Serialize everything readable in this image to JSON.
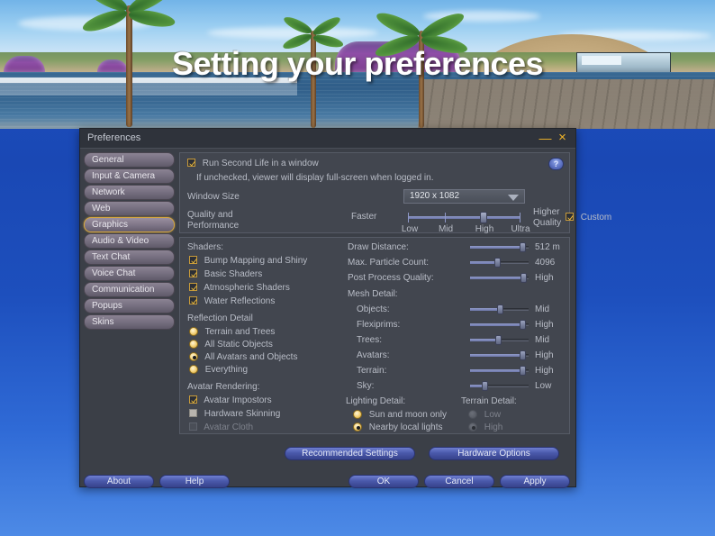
{
  "slide": {
    "title": "Setting your preferences"
  },
  "window": {
    "title": "Preferences",
    "minimize_label": "—",
    "close_label": "×",
    "help_label": "?"
  },
  "sidebar": {
    "items": [
      {
        "label": "General",
        "selected": false
      },
      {
        "label": "Input & Camera",
        "selected": false
      },
      {
        "label": "Network",
        "selected": false
      },
      {
        "label": "Web",
        "selected": false
      },
      {
        "label": "Graphics",
        "selected": true
      },
      {
        "label": "Audio & Video",
        "selected": false
      },
      {
        "label": "Text Chat",
        "selected": false
      },
      {
        "label": "Voice Chat",
        "selected": false
      },
      {
        "label": "Communication",
        "selected": false
      },
      {
        "label": "Popups",
        "selected": false
      },
      {
        "label": "Skins",
        "selected": false
      }
    ]
  },
  "top_panel": {
    "run_in_window_label": "Run Second Life in a window",
    "run_in_window_checked": true,
    "hint": "If unchecked, viewer will display full-screen when logged in.",
    "window_size_label": "Window Size",
    "window_size_value": "1920 x 1082",
    "quality_label_line1": "Quality and",
    "quality_label_line2": "Performance",
    "faster_label": "Faster",
    "higher_quality_line1": "Higher",
    "higher_quality_line2": "Quality",
    "quality_ticks": [
      "Low",
      "Mid",
      "High",
      "Ultra"
    ],
    "quality_value": "High",
    "custom_label": "Custom",
    "custom_checked": true
  },
  "shaders": {
    "heading": "Shaders:",
    "items": [
      {
        "label": "Bump Mapping and Shiny",
        "checked": true
      },
      {
        "label": "Basic Shaders",
        "checked": true
      },
      {
        "label": "Atmospheric Shaders",
        "checked": true
      },
      {
        "label": "Water Reflections",
        "checked": true
      }
    ]
  },
  "reflection_detail": {
    "heading": "Reflection Detail",
    "options": [
      {
        "label": "Terrain and Trees",
        "selected": false
      },
      {
        "label": "All Static Objects",
        "selected": false
      },
      {
        "label": "All Avatars and Objects",
        "selected": true
      },
      {
        "label": "Everything",
        "selected": false
      }
    ]
  },
  "avatar_rendering": {
    "heading": "Avatar Rendering:",
    "items": [
      {
        "label": "Avatar Impostors",
        "checked": true,
        "disabled": false
      },
      {
        "label": "Hardware Skinning",
        "checked": false,
        "disabled": false
      },
      {
        "label": "Avatar Cloth",
        "checked": false,
        "disabled": true
      }
    ]
  },
  "sliders": {
    "items": [
      {
        "label": "Draw Distance:",
        "value": "512 m",
        "pct": 88
      },
      {
        "label": "Max. Particle Count:",
        "value": "4096",
        "pct": 45
      },
      {
        "label": "Post Process Quality:",
        "value": "High",
        "pct": 90
      }
    ],
    "mesh_heading": "Mesh Detail:",
    "mesh": [
      {
        "label": "Objects:",
        "value": "Mid",
        "pct": 50
      },
      {
        "label": "Flexiprims:",
        "value": "High",
        "pct": 89
      },
      {
        "label": "Trees:",
        "value": "Mid",
        "pct": 46
      },
      {
        "label": "Avatars:",
        "value": "High",
        "pct": 89
      },
      {
        "label": "Terrain:",
        "value": "High",
        "pct": 89
      },
      {
        "label": "Sky:",
        "value": "Low",
        "pct": 25
      }
    ]
  },
  "lighting_detail": {
    "heading": "Lighting Detail:",
    "options": [
      {
        "label": "Sun and moon only",
        "selected": false
      },
      {
        "label": "Nearby local lights",
        "selected": true
      }
    ]
  },
  "terrain_detail": {
    "heading": "Terrain Detail:",
    "options": [
      {
        "label": "Low",
        "selected": false,
        "disabled": true
      },
      {
        "label": "High",
        "selected": true,
        "disabled": true
      }
    ]
  },
  "actions": {
    "recommended_settings": "Recommended Settings",
    "hardware_options": "Hardware Options",
    "about": "About",
    "help": "Help",
    "ok": "OK",
    "cancel": "Cancel",
    "apply": "Apply"
  },
  "colors": {
    "accent_gold": "#d8a840",
    "button_blue": "#4a59ab",
    "panel_bg": "#42464f",
    "window_bg": "#3b3f47"
  }
}
